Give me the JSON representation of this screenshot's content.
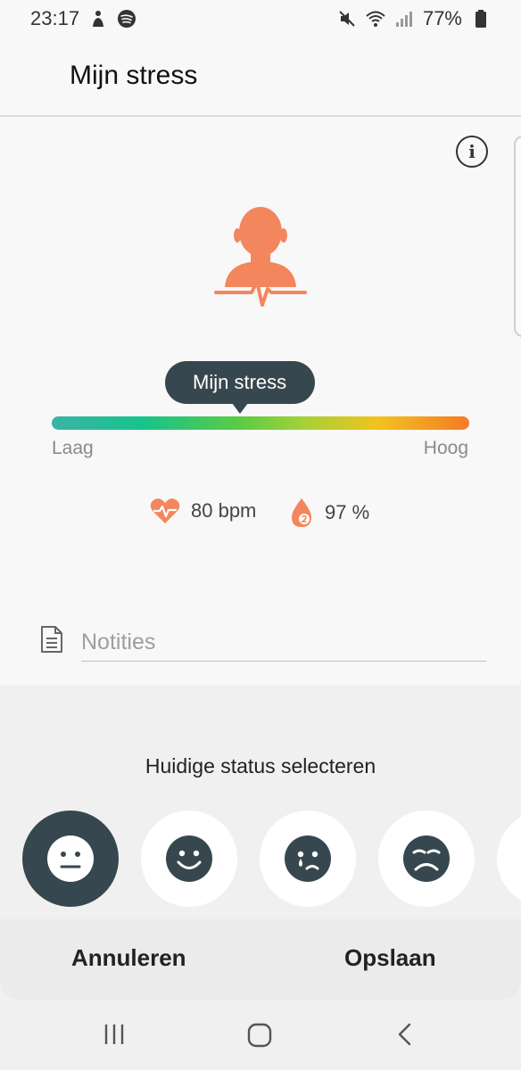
{
  "status_bar": {
    "time": "23:17",
    "battery": "77%",
    "icons": [
      "app-notification-icon",
      "spotify-icon",
      "mute-icon",
      "wifi-icon",
      "signal-icon",
      "battery-icon"
    ]
  },
  "header": {
    "title": "Mijn stress"
  },
  "stress": {
    "tooltip": "Mijn stress",
    "low_label": "Laag",
    "high_label": "Hoog",
    "level_fraction": 0.45
  },
  "metrics": {
    "heart_rate": "80 bpm",
    "spo2": "97 %"
  },
  "notes": {
    "placeholder": "Notities"
  },
  "status_select": {
    "title": "Huidige status selecteren",
    "moods": [
      "neutral-face-icon",
      "smile-face-icon",
      "crying-face-icon",
      "sad-face-icon"
    ]
  },
  "actions": {
    "cancel": "Annuleren",
    "save": "Opslaan"
  },
  "colors": {
    "accent": "#f4865e",
    "dark": "#37474f",
    "gradient": [
      "#3bb4a4",
      "#17c38a",
      "#5ccb45",
      "#a3d138",
      "#f2c21f",
      "#f47b26"
    ]
  }
}
